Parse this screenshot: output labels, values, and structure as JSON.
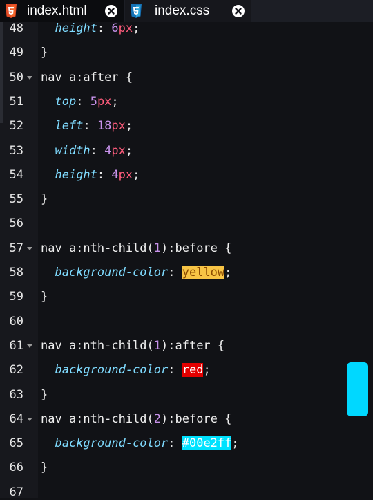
{
  "tabs": [
    {
      "label": "index.html",
      "icon": "html5-icon",
      "active": true
    },
    {
      "label": "index.css",
      "icon": "css3-icon",
      "active": false
    }
  ],
  "colors": {
    "html_icon": "#e44d26",
    "css_icon": "#1572b6",
    "scrollbar": "#00d8ff",
    "highlight_yellow": "#f8c445",
    "highlight_red": "#e30000",
    "highlight_cyan": "#00e2ff"
  },
  "editor": {
    "lines": [
      {
        "n": "48",
        "fold": false,
        "tokens": [
          {
            "t": "  "
          },
          {
            "t": "height",
            "c": "prop"
          },
          {
            "t": ": ",
            "c": "pun"
          },
          {
            "t": "6",
            "c": "num"
          },
          {
            "t": "px",
            "c": "unit"
          },
          {
            "t": ";",
            "c": "pun"
          }
        ]
      },
      {
        "n": "49",
        "fold": false,
        "tokens": [
          {
            "t": "}",
            "c": "pun"
          }
        ]
      },
      {
        "n": "50",
        "fold": true,
        "tokens": [
          {
            "t": "nav a:after {",
            "c": "sel"
          }
        ]
      },
      {
        "n": "51",
        "fold": false,
        "tokens": [
          {
            "t": "  "
          },
          {
            "t": "top",
            "c": "prop"
          },
          {
            "t": ": ",
            "c": "pun"
          },
          {
            "t": "5",
            "c": "num"
          },
          {
            "t": "px",
            "c": "unit"
          },
          {
            "t": ";",
            "c": "pun"
          }
        ]
      },
      {
        "n": "52",
        "fold": false,
        "tokens": [
          {
            "t": "  "
          },
          {
            "t": "left",
            "c": "prop"
          },
          {
            "t": ": ",
            "c": "pun"
          },
          {
            "t": "18",
            "c": "num"
          },
          {
            "t": "px",
            "c": "unit"
          },
          {
            "t": ";",
            "c": "pun"
          }
        ]
      },
      {
        "n": "53",
        "fold": false,
        "tokens": [
          {
            "t": "  "
          },
          {
            "t": "width",
            "c": "prop"
          },
          {
            "t": ": ",
            "c": "pun"
          },
          {
            "t": "4",
            "c": "num"
          },
          {
            "t": "px",
            "c": "unit"
          },
          {
            "t": ";",
            "c": "pun"
          }
        ]
      },
      {
        "n": "54",
        "fold": false,
        "tokens": [
          {
            "t": "  "
          },
          {
            "t": "height",
            "c": "prop"
          },
          {
            "t": ": ",
            "c": "pun"
          },
          {
            "t": "4",
            "c": "num"
          },
          {
            "t": "px",
            "c": "unit"
          },
          {
            "t": ";",
            "c": "pun"
          }
        ]
      },
      {
        "n": "55",
        "fold": false,
        "tokens": [
          {
            "t": "}",
            "c": "pun"
          }
        ]
      },
      {
        "n": "56",
        "fold": false,
        "tokens": []
      },
      {
        "n": "57",
        "fold": true,
        "tokens": [
          {
            "t": "nav a:nth-child(",
            "c": "sel"
          },
          {
            "t": "1",
            "c": "num"
          },
          {
            "t": "):before {",
            "c": "sel"
          }
        ]
      },
      {
        "n": "58",
        "fold": false,
        "tokens": [
          {
            "t": "  "
          },
          {
            "t": "background-color",
            "c": "prop"
          },
          {
            "t": ": ",
            "c": "pun"
          },
          {
            "t": "yellow",
            "c": "hl-yellow"
          },
          {
            "t": ";",
            "c": "pun"
          }
        ]
      },
      {
        "n": "59",
        "fold": false,
        "tokens": [
          {
            "t": "}",
            "c": "pun"
          }
        ]
      },
      {
        "n": "60",
        "fold": false,
        "tokens": []
      },
      {
        "n": "61",
        "fold": true,
        "tokens": [
          {
            "t": "nav a:nth-child(",
            "c": "sel"
          },
          {
            "t": "1",
            "c": "num"
          },
          {
            "t": "):after {",
            "c": "sel"
          }
        ]
      },
      {
        "n": "62",
        "fold": false,
        "tokens": [
          {
            "t": "  "
          },
          {
            "t": "background-color",
            "c": "prop"
          },
          {
            "t": ": ",
            "c": "pun"
          },
          {
            "t": "red",
            "c": "hl-red"
          },
          {
            "t": ";",
            "c": "pun"
          }
        ]
      },
      {
        "n": "63",
        "fold": false,
        "tokens": [
          {
            "t": "}",
            "c": "pun"
          }
        ]
      },
      {
        "n": "64",
        "fold": true,
        "tokens": [
          {
            "t": "nav a:nth-child(",
            "c": "sel"
          },
          {
            "t": "2",
            "c": "num"
          },
          {
            "t": "):before {",
            "c": "sel"
          }
        ]
      },
      {
        "n": "65",
        "fold": false,
        "tokens": [
          {
            "t": "  "
          },
          {
            "t": "background-color",
            "c": "prop"
          },
          {
            "t": ": ",
            "c": "pun"
          },
          {
            "t": "#00e2ff",
            "c": "hl-cyan"
          },
          {
            "t": ";",
            "c": "pun"
          }
        ]
      },
      {
        "n": "66",
        "fold": false,
        "tokens": [
          {
            "t": "}",
            "c": "pun"
          }
        ]
      },
      {
        "n": "67",
        "fold": false,
        "tokens": []
      }
    ]
  }
}
